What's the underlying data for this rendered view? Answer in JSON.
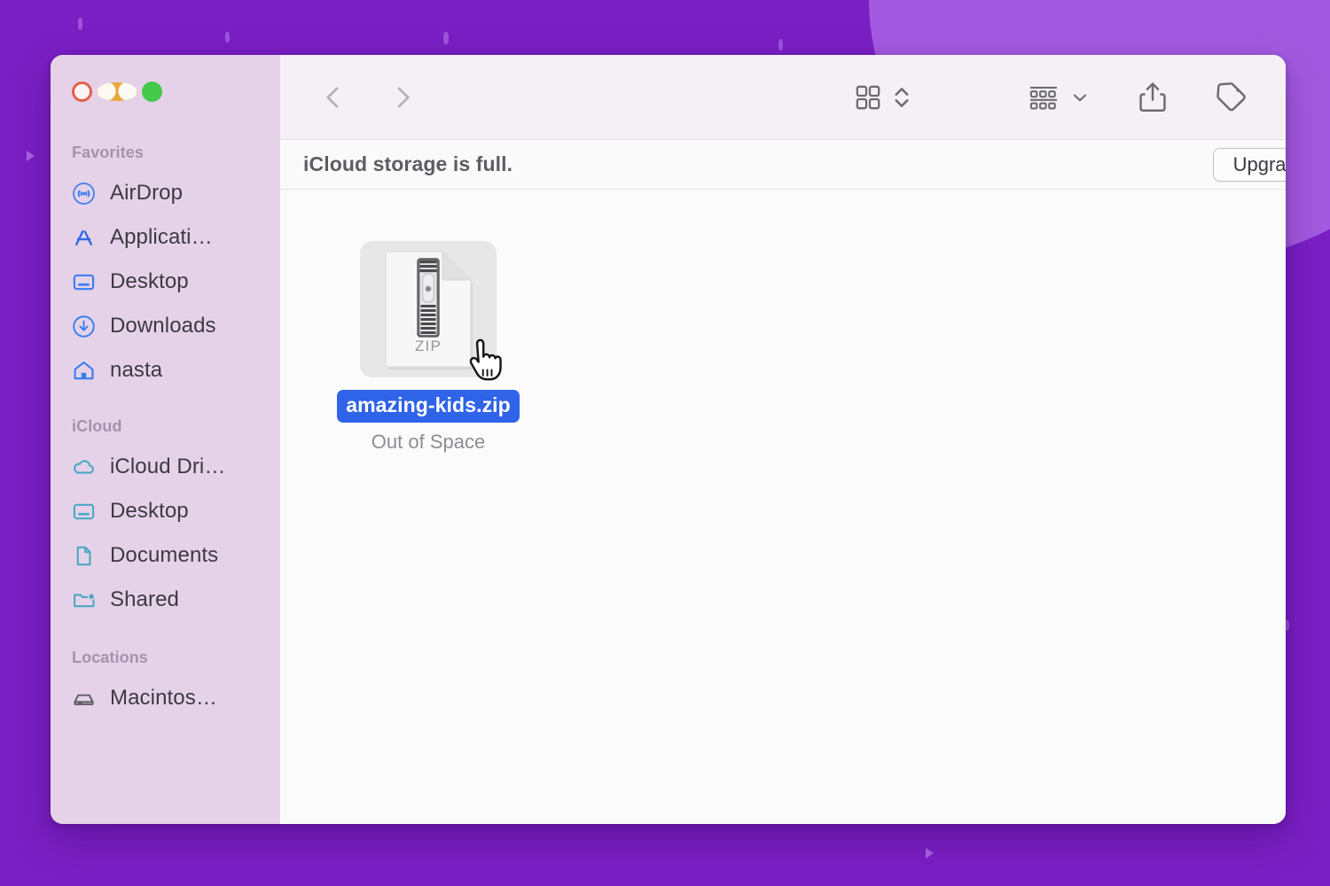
{
  "window": {
    "traffic_lights": [
      "close",
      "minimize",
      "maximize"
    ]
  },
  "toolbar": {
    "back_label": "Back",
    "forward_label": "Forward",
    "view_label": "Icon View",
    "view_sort_label": "Sort Order",
    "group_label": "Group By",
    "group_chevron_label": "Group Options",
    "share_label": "Share",
    "tags_label": "Tags"
  },
  "banner": {
    "message": "iCloud storage is full.",
    "upgrade_label": "Upgrade"
  },
  "sidebar": {
    "sections": [
      {
        "title": "Favorites",
        "items": [
          {
            "label": "AirDrop",
            "icon": "airdrop-icon",
            "color": "#3a7ef0"
          },
          {
            "label": "Applicati…",
            "icon": "applications-icon",
            "color": "#2f6ae8"
          },
          {
            "label": "Desktop",
            "icon": "desktop-icon",
            "color": "#3a7ef0"
          },
          {
            "label": "Downloads",
            "icon": "downloads-icon",
            "color": "#3a7ef0"
          },
          {
            "label": "nasta",
            "icon": "home-icon",
            "color": "#3a7ef0"
          }
        ]
      },
      {
        "title": "iCloud",
        "items": [
          {
            "label": "iCloud Dri…",
            "icon": "cloud-icon",
            "color": "#4aa8c4"
          },
          {
            "label": "Desktop",
            "icon": "desktop-icon",
            "color": "#4aa8c4"
          },
          {
            "label": "Documents",
            "icon": "document-icon",
            "color": "#4aa8c4"
          },
          {
            "label": "Shared",
            "icon": "shared-folder-icon",
            "color": "#4aa8c4"
          }
        ]
      },
      {
        "title": "Locations",
        "items": [
          {
            "label": "Macintos…",
            "icon": "hard-drive-icon",
            "color": "#5e5c63"
          }
        ]
      }
    ]
  },
  "file": {
    "name": "amazing-kids.zip",
    "status": "Out of Space",
    "type_badge": "ZIP",
    "selected": true
  },
  "colors": {
    "background": "#7a1fc4",
    "background_blob": "#a45ae0",
    "sidebar": "#e6d2e8",
    "toolbar": "#f5f0f5",
    "content": "#fcfbfc",
    "selection": "#2f63e8",
    "favorites_icon": "#3a7ef0",
    "icloud_icon": "#4aa8c4"
  }
}
